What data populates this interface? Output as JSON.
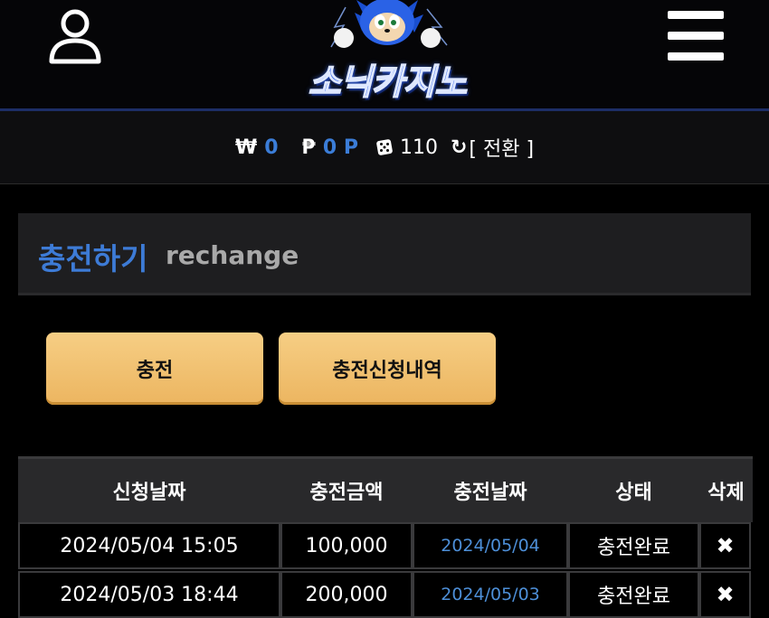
{
  "header": {
    "logo_text": "소닉카지노",
    "user_icon": "user-icon",
    "menu_icon": "hamburger-menu-icon"
  },
  "balance": {
    "won_symbol": "₩",
    "won_value": "0",
    "point_symbol": "₱",
    "point_value": "0 P",
    "dice_icon": "dice-icon",
    "dice_value": "110",
    "refresh_icon": "refresh-icon",
    "switch_label": "[ 전환 ]"
  },
  "page": {
    "title_ko": "충전하기",
    "title_en": "rechange"
  },
  "buttons": {
    "charge_label": "충전",
    "history_label": "충전신청내역"
  },
  "table": {
    "headers": [
      "신청날짜",
      "충전금액",
      "충전날짜",
      "상태",
      "삭제"
    ],
    "rows": [
      {
        "request_date": "2024/05/04 15:05",
        "amount": "100,000",
        "charge_date": "2024/05/04",
        "status": "충전완료",
        "delete": "✖"
      },
      {
        "request_date": "2024/05/03 18:44",
        "amount": "200,000",
        "charge_date": "2024/05/03",
        "status": "충전완료",
        "delete": "✖"
      }
    ]
  },
  "colors": {
    "accent_blue": "#3d7bd6",
    "button_gold": "#f0c270",
    "header_divider": "#1d2e66"
  }
}
